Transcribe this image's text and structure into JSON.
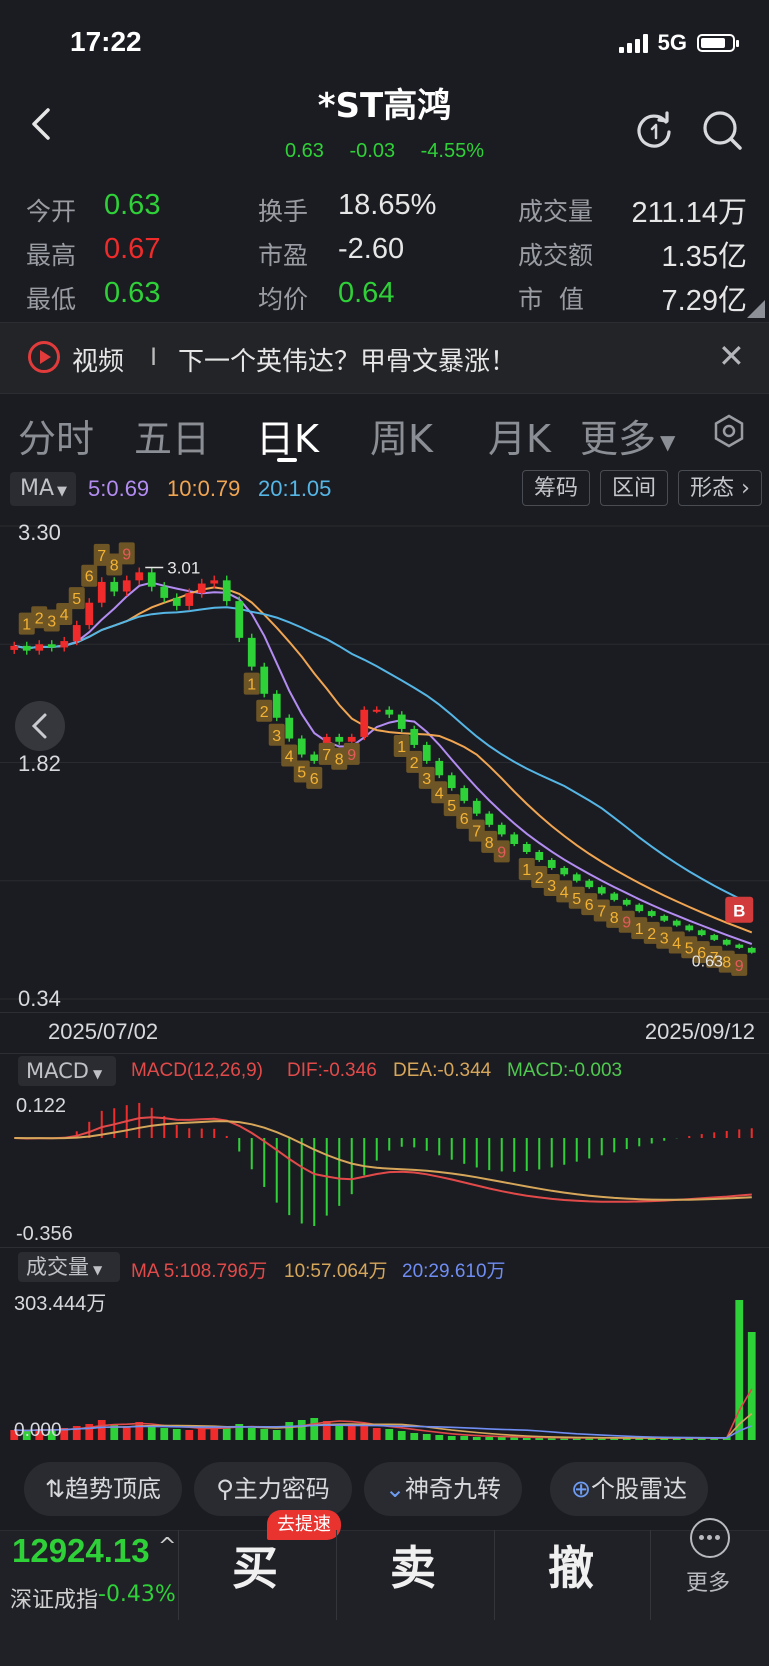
{
  "status_bar": {
    "time": "17:22",
    "network": "5G"
  },
  "header": {
    "title": "*ST高鸿",
    "price": "0.63",
    "change": "-0.03",
    "change_pct": "-4.55%"
  },
  "quote": {
    "open_label": "今开",
    "open": "0.63",
    "high_label": "最高",
    "high": "0.67",
    "low_label": "最低",
    "low": "0.63",
    "turnover_label": "换手",
    "turnover": "18.65%",
    "pe_label": "市盈",
    "pe": "-2.60",
    "avg_label": "均价",
    "avg": "0.64",
    "volume_label": "成交量",
    "volume": "211.14万",
    "amount_label": "成交额",
    "amount": "1.35亿",
    "mcap_label": "市  值",
    "mcap": "7.29亿"
  },
  "banner": {
    "tag": "视频",
    "sep": "I",
    "text": "下一个英伟达？甲骨文暴涨！"
  },
  "tabs": [
    "分时",
    "五日",
    "日K",
    "周K",
    "月K",
    "更多"
  ],
  "active_tab": "日K",
  "toolbar": {
    "ma_label": "MA",
    "ma5": "5:0.69",
    "ma10": "10:0.79",
    "ma20": "20:1.05",
    "btn_chips": "筹码",
    "btn_range": "区间",
    "btn_pattern": "形态"
  },
  "colors": {
    "up": "#ef2b2b",
    "down": "#2fd138",
    "ma5": "#b38cf2",
    "ma10": "#f0a552",
    "ma20": "#55b6e6",
    "nine_bg": "#6e5526",
    "nine_text": "#f2b234"
  },
  "kline": {
    "y_max_label": "3.30",
    "y_mid_label": "1.82",
    "y_min_label": "0.34",
    "start_date": "2025/07/02",
    "end_date": "2025/09/12",
    "high_marker": "3.01",
    "low_marker": "0.63",
    "buy_signal": "B"
  },
  "macd": {
    "title": "MACD",
    "params": "MACD(12,26,9)",
    "dif": "DIF:-0.346",
    "dea": "DEA:-0.344",
    "macd": "MACD:-0.003",
    "y_max_label": "0.122",
    "y_min_label": "-0.356"
  },
  "volume": {
    "title": "成交量",
    "ma5": "MA 5:108.796万",
    "ma10": "10:57.064万",
    "ma20": "20:29.610万",
    "y_max_label": "303.444万",
    "y_min_label": "0.000"
  },
  "chart_data": {
    "type": "candlestick",
    "title": "",
    "x_range": [
      "2025/07/02",
      "2025/09/12"
    ],
    "ylim": [
      0.34,
      3.3
    ],
    "closes_approx": [
      2.55,
      2.52,
      2.56,
      2.54,
      2.58,
      2.68,
      2.82,
      2.95,
      2.89,
      2.96,
      3.01,
      2.92,
      2.85,
      2.8,
      2.88,
      2.94,
      2.96,
      2.83,
      2.6,
      2.42,
      2.25,
      2.1,
      1.97,
      1.87,
      1.83,
      1.98,
      1.95,
      1.98,
      2.15,
      2.15,
      2.12,
      2.03,
      1.93,
      1.83,
      1.74,
      1.66,
      1.58,
      1.5,
      1.43,
      1.37,
      1.31,
      1.26,
      1.21,
      1.16,
      1.12,
      1.08,
      1.04,
      1.0,
      0.96,
      0.93,
      0.89,
      0.86,
      0.83,
      0.8,
      0.77,
      0.74,
      0.71,
      0.68,
      0.66,
      0.63
    ]
  },
  "quick_tools": [
    "趋势顶底",
    "主力密码",
    "神奇九转",
    "个股雷达"
  ],
  "bottom": {
    "index_value": "12924.13",
    "index_name": "深证成指",
    "index_change": "-0.43%",
    "buy": "买",
    "sell": "卖",
    "cancel": "撤",
    "more": "更多",
    "fast_badge": "去提速"
  }
}
